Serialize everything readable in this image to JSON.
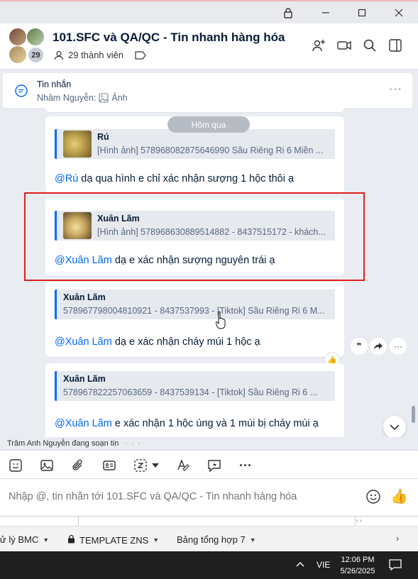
{
  "window": {
    "lock_icon": "lock-icon",
    "minimize": "minimize-icon",
    "maximize": "maximize-icon",
    "close": "close-icon"
  },
  "header": {
    "title": "101.SFC và QA/QC - Tin nhanh hàng hóa",
    "member_count_badge": "29",
    "members_label": "29 thành viên"
  },
  "pinned": {
    "title": "Tin nhắn",
    "sender": "Nhâm Nguyễn:",
    "content": "Ảnh"
  },
  "chat": {
    "date_chip": "Hôm qua",
    "messages": [
      {
        "quote_name": "Rú",
        "quote_text": "[Hình ảnh] 578968082875646990 Sầu Riêng Ri 6 Miền ...",
        "mention": "@Rú",
        "text": " dạ qua hình e chỉ xác nhận sượng 1 hộc thôi ạ"
      },
      {
        "quote_name": "Xuân Lãm",
        "quote_text": "[Hình ảnh] 578968630889514882 - 8437515172 - khách...",
        "mention": "@Xuân Lãm",
        "text": " dạ e xác nhận sượng nguyên trái ạ"
      },
      {
        "quote_name": "Xuân Lãm",
        "quote_text": "578967798004810921 - 8437537993 - [Tiktok] Sầu Riêng Ri 6 M...",
        "mention": "@Xuân Lãm",
        "text": " dạ e xác nhận cháy múi 1 hộc ạ"
      },
      {
        "quote_name": "Xuân Lãm",
        "quote_text": "578967822257063659 - 8437539134 - [Tiktok] Sầu Riêng Ri 6 ...",
        "mention": "@Xuân Lãm",
        "text": " e xác nhận 1 hộc úng và 1 múi bị cháy múi ạ"
      }
    ]
  },
  "typing_indicator": "Trâm Anh Nguyễn đang soạn tin",
  "composer": {
    "placeholder": "Nhập @, tin nhắn tới 101.SFC và QA/QC - Tin nhanh hàng hóa"
  },
  "sheet_tabs": [
    {
      "label": "ử lý BMC"
    },
    {
      "label": "TEMPLATE ZNS"
    },
    {
      "label": "Bảng tổng hợp 7"
    }
  ],
  "taskbar": {
    "lang": "VIE",
    "time": "12:06 PM",
    "date": "5/26/2025"
  },
  "colors": {
    "accent": "#0068ff",
    "highlight": "#e02020"
  }
}
